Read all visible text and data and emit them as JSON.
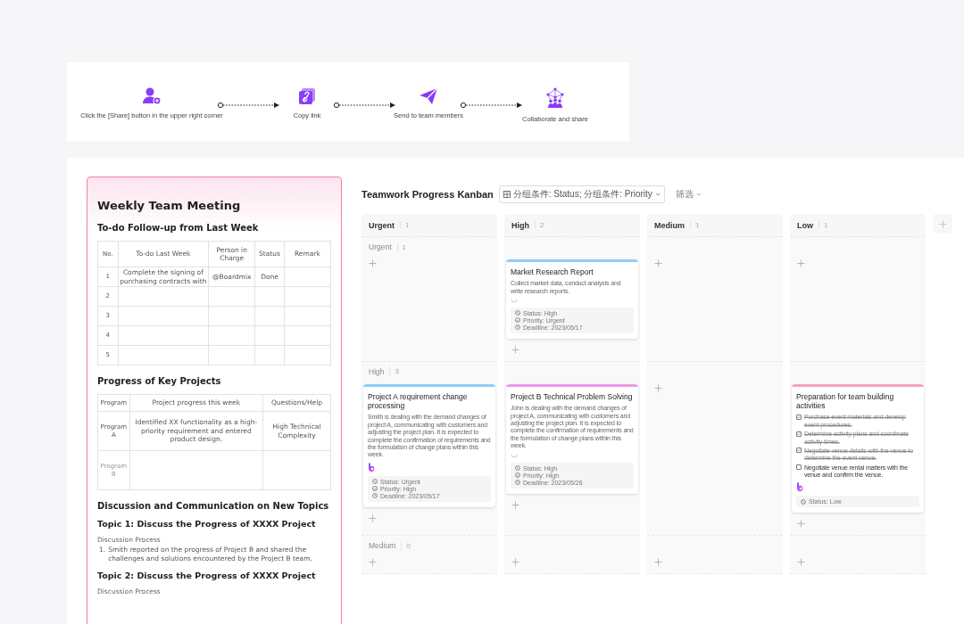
{
  "share_steps": [
    {
      "label": "Click the [Share] button in the upper right corner"
    },
    {
      "label": "Copy link"
    },
    {
      "label": "Send to team members"
    },
    {
      "label": "Collaborate and share"
    }
  ],
  "document": {
    "title": "Weekly Team Meeting",
    "todo_heading": "To-do Follow-up from Last Week",
    "todo_table": {
      "columns": [
        "No.",
        "To-do Last Week",
        "Person in Charge",
        "Status",
        "Remark"
      ],
      "rows": [
        {
          "no": "1",
          "todo": "Complete the signing of purchasing contracts with",
          "person": "@Boardmix",
          "status": "Done"
        },
        {
          "no": "2"
        },
        {
          "no": "3"
        },
        {
          "no": "4"
        },
        {
          "no": "5"
        }
      ]
    },
    "projects_heading": "Progress of Key Projects",
    "projects_table": {
      "columns": [
        "Program",
        "Project progress this week",
        "Questions/Help"
      ],
      "rows": [
        {
          "program": "Program A",
          "progress": "Identified XX functionality as a high-priority requirement and entered product design.",
          "questions": "High Technical Complexity"
        },
        {
          "program": "Program B"
        }
      ]
    },
    "discussion_heading": "Discussion and Communication on New Topics",
    "topics": [
      {
        "title": "Topic 1: Discuss the Progress of XXXX Project",
        "process_label": "Discussion Process",
        "items": [
          {
            "number": "1.",
            "text": "Smith reported on the progress of Project B and shared the challenges and solutions encountered by the Project B team."
          }
        ]
      },
      {
        "title": "Topic 2: Discuss the Progress of XXXX Project",
        "process_label": "Discussion Process"
      }
    ]
  },
  "kanban": {
    "title": "Teamwork Progress Kanban",
    "group_selector": "分组条件: Status; 分组条件: Priority",
    "filter_label": "筛选",
    "columns": [
      {
        "name": "Urgent",
        "count": "1"
      },
      {
        "name": "High",
        "count": "2"
      },
      {
        "name": "Medium",
        "count": "1"
      },
      {
        "name": "Low",
        "count": "1"
      }
    ],
    "lanes": [
      {
        "name": "Urgent",
        "count": "1",
        "cells": [
          {},
          {
            "cards": [
              {
                "title": "Market Research Report",
                "color": "#8ecdf6",
                "description": "Collect market data, conduct analysis and write research reports.",
                "avatar": {
                  "kind": "placeholder"
                },
                "fields": [
                  {
                    "kind": "status",
                    "text": "Status: High"
                  },
                  {
                    "kind": "priority",
                    "text": "Priority: Urgent"
                  },
                  {
                    "kind": "deadline",
                    "text": "Deadline: 2023/05/17"
                  }
                ]
              }
            ]
          },
          {},
          {}
        ]
      },
      {
        "name": "High",
        "count": "3",
        "cells": [
          {
            "cards": [
              {
                "title": "Project A requirement change processing",
                "color": "#8ecdf6",
                "description": "Smith is dealing with the demand changes of project A, communicating with customers and adjusting the project plan. It is expected to complete the confirmation of requirements and the formulation of change plans within this week.",
                "avatar": {
                  "kind": "logo"
                },
                "fields": [
                  {
                    "kind": "status",
                    "text": "Status: Urgent"
                  },
                  {
                    "kind": "priority",
                    "text": "Priority: High"
                  },
                  {
                    "kind": "deadline",
                    "text": "Deadline: 2023/05/17"
                  }
                ]
              }
            ]
          },
          {
            "cards": [
              {
                "title": "Project B Technical Problem Solving",
                "color": "#e99ae8",
                "description": "John is dealing with the demand changes of project A, communicating with customers and adjusting the project plan. It is expected to complete the confirmation of requirements and the formulation of change plans within this week.",
                "avatar": {
                  "kind": "placeholder"
                },
                "fields": [
                  {
                    "kind": "status",
                    "text": "Status: High"
                  },
                  {
                    "kind": "priority",
                    "text": "Priority: High"
                  },
                  {
                    "kind": "deadline",
                    "text": "Deadline: 2023/05/26"
                  }
                ]
              }
            ]
          },
          {},
          {
            "cards": [
              {
                "title": "Preparation for team building activities",
                "color": "#f5a3b8",
                "checklist": [
                  {
                    "text": "Purchase event materials and develop event procedures.",
                    "checked": true
                  },
                  {
                    "text": "Determine activity plans and coordinate activity times.",
                    "checked": true
                  },
                  {
                    "text": "Negotiate venue details with the venue to determine the event venue.",
                    "checked": true
                  },
                  {
                    "text": "Negotiate venue rental matters with the venue and confirm the venue.",
                    "checked": false
                  }
                ],
                "avatar": {
                  "kind": "logo"
                },
                "fields": [
                  {
                    "kind": "status",
                    "text": "Status: Low"
                  }
                ]
              }
            ]
          }
        ]
      },
      {
        "name": "Medium",
        "count": "0",
        "cells": [
          {},
          {},
          {},
          {}
        ]
      }
    ]
  }
}
